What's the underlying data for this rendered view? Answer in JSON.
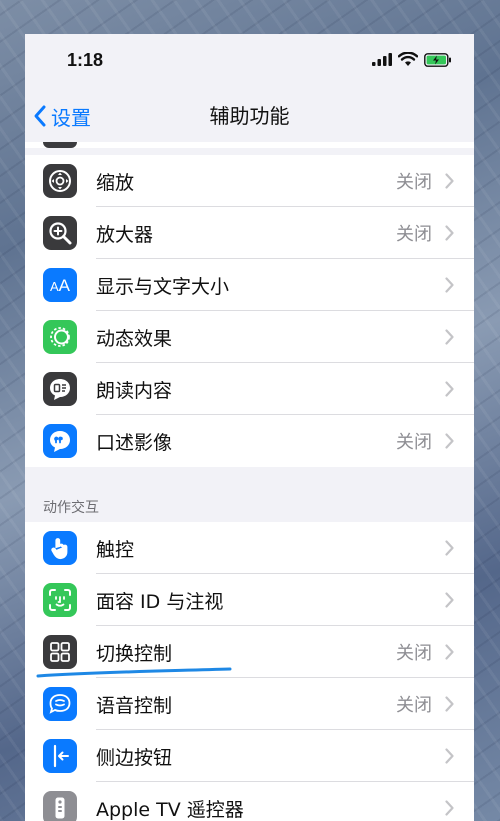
{
  "status_bar": {
    "time": "1:18"
  },
  "nav": {
    "back_label": "设置",
    "title": "辅助功能"
  },
  "vision_rows": [
    {
      "label": "缩放",
      "value": "关闭",
      "icon": "zoom-icon",
      "color": "#3a3a3c"
    },
    {
      "label": "放大器",
      "value": "关闭",
      "icon": "magnifier-icon",
      "color": "#3a3a3c"
    },
    {
      "label": "显示与文字大小",
      "value": "",
      "icon": "text-size-icon",
      "color": "#0a7aff"
    },
    {
      "label": "动态效果",
      "value": "",
      "icon": "motion-icon",
      "color": "#34c759"
    },
    {
      "label": "朗读内容",
      "value": "",
      "icon": "spoken-content-icon",
      "color": "#3a3a3c"
    },
    {
      "label": "口述影像",
      "value": "关闭",
      "icon": "audio-description-icon",
      "color": "#0a7aff"
    }
  ],
  "interaction_section": {
    "header": "动作交互"
  },
  "interaction_rows": [
    {
      "label": "触控",
      "value": "",
      "icon": "touch-icon",
      "color": "#0a7aff"
    },
    {
      "label": "面容 ID 与注视",
      "value": "",
      "icon": "face-id-icon",
      "color": "#34c759"
    },
    {
      "label": "切换控制",
      "value": "关闭",
      "icon": "switch-control-icon",
      "color": "#3a3a3c"
    },
    {
      "label": "语音控制",
      "value": "关闭",
      "icon": "voice-control-icon",
      "color": "#0a7aff"
    },
    {
      "label": "侧边按钮",
      "value": "",
      "icon": "side-button-icon",
      "color": "#0a7aff"
    },
    {
      "label": "Apple TV 遥控器",
      "value": "",
      "icon": "tv-remote-icon",
      "color": "#8e8e93"
    }
  ],
  "colors": {
    "accent": "#0a7aff",
    "annotation": "#1e88e5",
    "battery": "#34c759"
  }
}
